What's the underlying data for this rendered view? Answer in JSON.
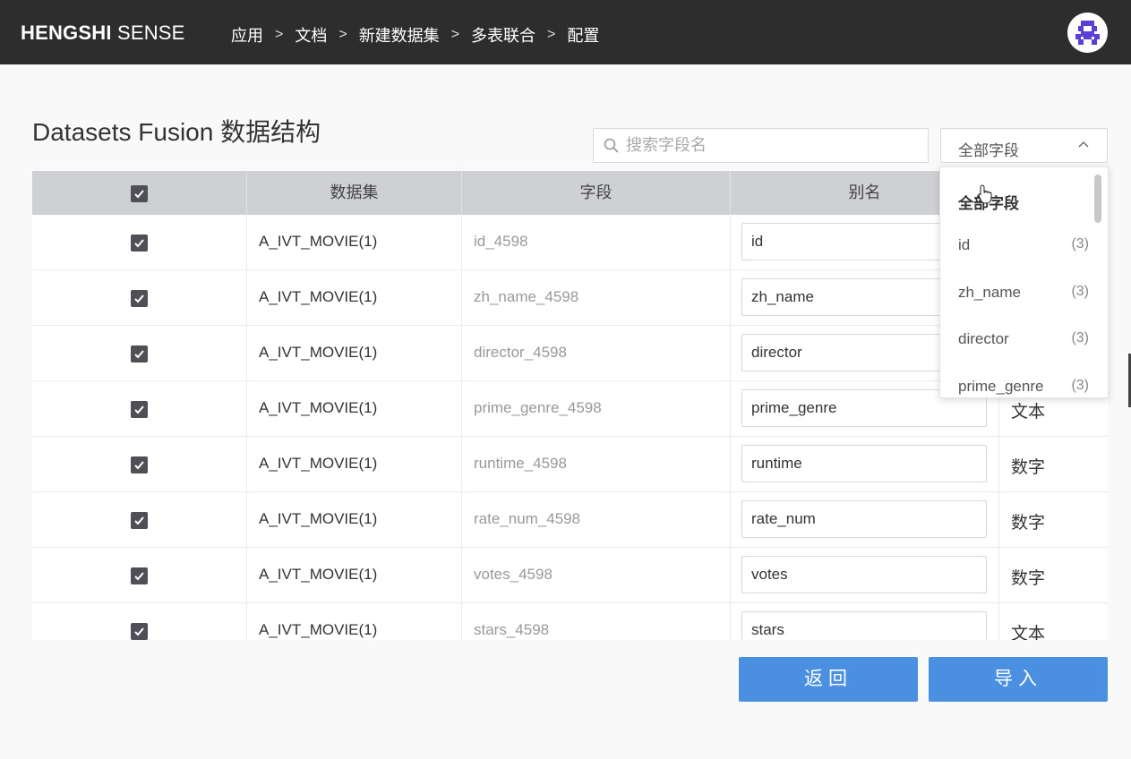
{
  "header": {
    "brand_bold": "HENGSHI",
    "brand_light": "SENSE",
    "breadcrumbs": [
      "应用",
      "文档",
      "新建数据集",
      "多表联合",
      "配置"
    ],
    "breadcrumb_separator": ">"
  },
  "page": {
    "title": "Datasets Fusion 数据结构"
  },
  "search": {
    "placeholder": "搜索字段名",
    "value": ""
  },
  "filter": {
    "selected": "全部字段",
    "options": [
      {
        "label": "全部字段",
        "count": ""
      },
      {
        "label": "id",
        "count": "(3)"
      },
      {
        "label": "zh_name",
        "count": "(3)"
      },
      {
        "label": "director",
        "count": "(3)"
      },
      {
        "label": "prime_genre",
        "count": "(3)"
      }
    ]
  },
  "table": {
    "headers": [
      "",
      "数据集",
      "字段",
      "别名",
      ""
    ],
    "rows": [
      {
        "checked": true,
        "dataset": "A_IVT_MOVIE(1)",
        "field": "id_4598",
        "alias": "id",
        "type": ""
      },
      {
        "checked": true,
        "dataset": "A_IVT_MOVIE(1)",
        "field": "zh_name_4598",
        "alias": "zh_name",
        "type": ""
      },
      {
        "checked": true,
        "dataset": "A_IVT_MOVIE(1)",
        "field": "director_4598",
        "alias": "director",
        "type": ""
      },
      {
        "checked": true,
        "dataset": "A_IVT_MOVIE(1)",
        "field": "prime_genre_4598",
        "alias": "prime_genre",
        "type": "文本"
      },
      {
        "checked": true,
        "dataset": "A_IVT_MOVIE(1)",
        "field": "runtime_4598",
        "alias": "runtime",
        "type": "数字"
      },
      {
        "checked": true,
        "dataset": "A_IVT_MOVIE(1)",
        "field": "rate_num_4598",
        "alias": "rate_num",
        "type": "数字"
      },
      {
        "checked": true,
        "dataset": "A_IVT_MOVIE(1)",
        "field": "votes_4598",
        "alias": "votes",
        "type": "数字"
      },
      {
        "checked": true,
        "dataset": "A_IVT_MOVIE(1)",
        "field": "stars_4598",
        "alias": "stars",
        "type": "文本"
      }
    ]
  },
  "actions": {
    "back_label": "返回",
    "import_label": "导入"
  },
  "colors": {
    "topbar": "#2d2d2d",
    "primary": "#4a8fe0",
    "table_header": "#cfd0d4",
    "checkbox": "#4f4f57",
    "avatar_icon": "#5b3fd6"
  },
  "icons": {
    "avatar": "pixel-avatar-icon",
    "search": "search-icon",
    "select": "chevron-up-icon",
    "checkbox": "checkmark-icon"
  }
}
